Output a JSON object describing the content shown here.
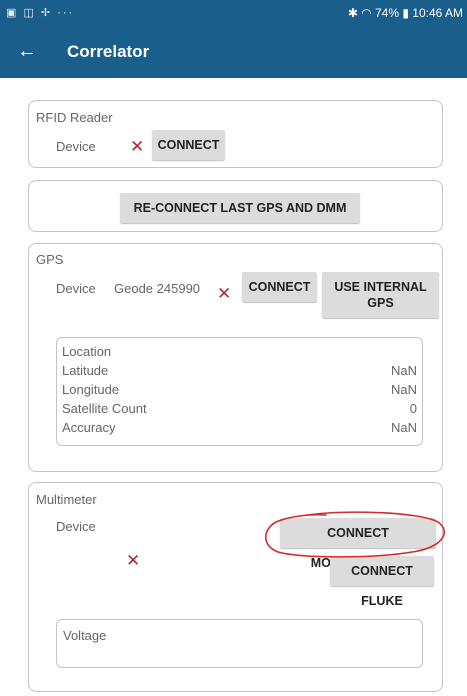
{
  "status": {
    "left_icons": "▣ ◫ ✢ ···",
    "right_text": "✱ ◠ 74% ▮ 10:46 AM"
  },
  "appbar": {
    "back": "←",
    "title": "Correlator"
  },
  "rfid": {
    "title": "RFID Reader",
    "device_label": "Device",
    "status_mark": "✕",
    "connect_label": "CONNECT"
  },
  "reconnect": {
    "label": "RE-CONNECT LAST GPS AND DMM"
  },
  "gps": {
    "title": "GPS",
    "device_label": "Device",
    "device_name": "Geode 245990",
    "status_mark": "✕",
    "connect_label": "CONNECT",
    "internal_label_line1": "USE INTERNAL",
    "internal_label_line2": "GPS",
    "location": {
      "header": "Location",
      "rows": [
        {
          "key": "Latitude",
          "value": "NaN"
        },
        {
          "key": "Longitude",
          "value": "NaN"
        },
        {
          "key": "Satellite Count",
          "value": "0"
        },
        {
          "key": "Accuracy",
          "value": "NaN"
        }
      ]
    }
  },
  "multimeter": {
    "title": "Multimeter",
    "device_label": "Device",
    "status_mark": "✕",
    "mooshimeter_label": "CONNECT MOOSHIMETER",
    "fluke_label": "CONNECT FLUKE",
    "voltage_label": "Voltage"
  },
  "colors": {
    "primary": "#1a5e8c",
    "error_mark": "#b5282e",
    "annotation": "#d42a2a",
    "button_bg": "#dcdcdc"
  }
}
